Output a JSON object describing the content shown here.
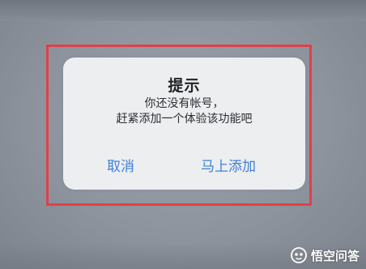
{
  "dialog": {
    "title": "提示",
    "message_line1": "你还没有帐号，",
    "message_line2": "赶紧添加一个体验该功能吧",
    "cancel_label": "取消",
    "confirm_label": "马上添加"
  },
  "watermark": {
    "text": "悟空问答",
    "icon": "wukong-logo-icon"
  },
  "colors": {
    "accent": "#3f7fd8",
    "highlight_frame": "#e0404a",
    "dialog_bg": "#eceef0"
  }
}
